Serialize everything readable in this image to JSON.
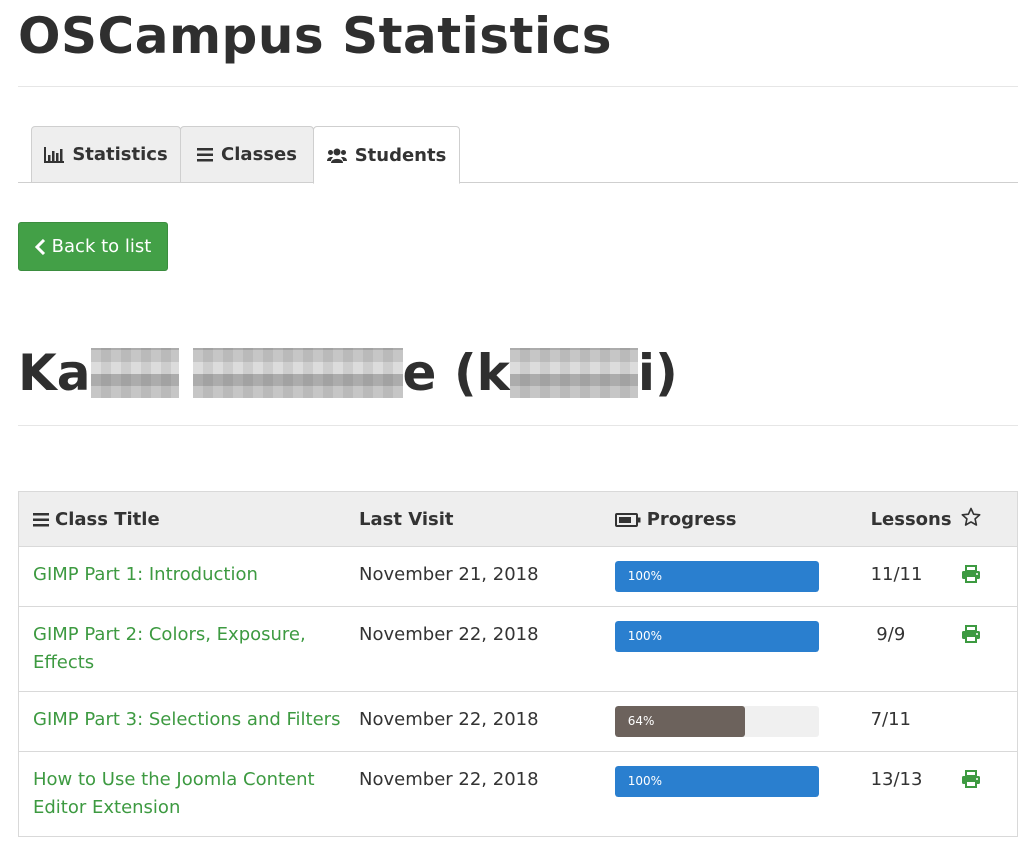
{
  "page": {
    "title": "OSCampus Statistics"
  },
  "tabs": [
    {
      "label": "Statistics",
      "icon": "bar-chart-icon",
      "active": false
    },
    {
      "label": "Classes",
      "icon": "list-icon",
      "active": false
    },
    {
      "label": "Students",
      "icon": "users-icon",
      "active": true
    }
  ],
  "back_button": {
    "label": "Back to list",
    "icon": "chevron-left-icon"
  },
  "student": {
    "name_start": "Ka",
    "name_middle": "e (k",
    "name_end": "i)"
  },
  "table": {
    "headers": {
      "title": "Class Title",
      "last_visit": "Last Visit",
      "progress": "Progress",
      "lessons": "Lessons"
    },
    "rows": [
      {
        "title": "GIMP Part 1: Introduction",
        "last_visit": "November 21, 2018",
        "progress": 100,
        "progress_label": "100%",
        "lessons": "11/11",
        "printable": true
      },
      {
        "title": "GIMP Part 2: Colors, Exposure, Effects",
        "last_visit": "November 22, 2018",
        "progress": 100,
        "progress_label": "100%",
        "lessons": " 9/9",
        "printable": true
      },
      {
        "title": "GIMP Part 3: Selections and Filters",
        "last_visit": "November 22, 2018",
        "progress": 64,
        "progress_label": "64%",
        "lessons": "7/11",
        "printable": false
      },
      {
        "title": "How to Use the Joomla Content Editor Extension",
        "last_visit": "November 22, 2018",
        "progress": 100,
        "progress_label": "100%",
        "lessons": "13/13",
        "printable": true
      }
    ]
  },
  "colors": {
    "accent_green": "#43a047",
    "link_green": "#3d9a41",
    "progress_complete": "#2a7fcf",
    "progress_partial": "#6c625c"
  }
}
